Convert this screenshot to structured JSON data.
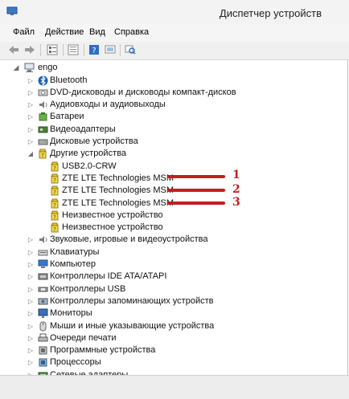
{
  "window": {
    "title": "Диспетчер устройств"
  },
  "menu": [
    "Файл",
    "Действие",
    "Вид",
    "Справка"
  ],
  "tree": {
    "root": "engo",
    "categories": [
      {
        "label": "Bluetooth",
        "icon": "bluetooth-icon"
      },
      {
        "label": "DVD-дисководы и дисководы компакт-дисков",
        "icon": "dvd-drive-icon"
      },
      {
        "label": "Аудиовходы и аудиовыходы",
        "icon": "speaker-icon"
      },
      {
        "label": "Батареи",
        "icon": "battery-icon"
      },
      {
        "label": "Видеоадаптеры",
        "icon": "display-adapter-icon"
      },
      {
        "label": "Дисковые устройства",
        "icon": "disk-drive-icon"
      },
      {
        "label": "Другие устройства",
        "icon": "unknown-device-icon",
        "expanded": true
      },
      {
        "label": "USB2.0-CRW",
        "icon": "unknown-device-icon",
        "child": true
      },
      {
        "label": "ZTE LTE Technologies MSM",
        "icon": "unknown-device-icon",
        "child": true
      },
      {
        "label": "ZTE LTE Technologies MSM",
        "icon": "unknown-device-icon",
        "child": true
      },
      {
        "label": "ZTE LTE Technologies MSM",
        "icon": "unknown-device-icon",
        "child": true
      },
      {
        "label": "Неизвестное устройство",
        "icon": "unknown-device-icon",
        "child": true
      },
      {
        "label": "Неизвестное устройство",
        "icon": "unknown-device-icon",
        "child": true
      },
      {
        "label": "Звуковые, игровые и видеоустройства",
        "icon": "speaker-icon"
      },
      {
        "label": "Клавиатуры",
        "icon": "keyboard-icon"
      },
      {
        "label": "Компьютер",
        "icon": "computer-icon"
      },
      {
        "label": "Контроллеры IDE ATA/ATAPI",
        "icon": "ide-controller-icon"
      },
      {
        "label": "Контроллеры USB",
        "icon": "usb-controller-icon"
      },
      {
        "label": "Контроллеры запоминающих устройств",
        "icon": "storage-controller-icon"
      },
      {
        "label": "Мониторы",
        "icon": "monitor-icon"
      },
      {
        "label": "Мыши и иные указывающие устройства",
        "icon": "mouse-icon"
      },
      {
        "label": "Очереди печати",
        "icon": "printer-icon"
      },
      {
        "label": "Программные устройства",
        "icon": "software-device-icon"
      },
      {
        "label": "Процессоры",
        "icon": "processor-icon"
      },
      {
        "label": "Сетевые адаптеры",
        "icon": "network-adapter-icon"
      }
    ]
  },
  "callouts": [
    "1",
    "2",
    "3"
  ],
  "colors": {
    "accent": "#c22020",
    "tree_bg": "#ffffff",
    "titlebar": "#f3f3f3"
  }
}
